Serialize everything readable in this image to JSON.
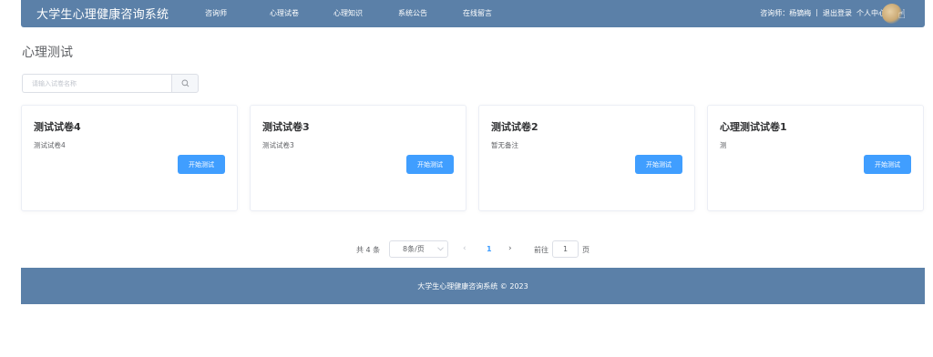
{
  "navbar": {
    "brand": "大学生心理健康咨询系统",
    "items": [
      "咨询师",
      "心理试卷",
      "心理知识",
      "系统公告",
      "在线留言"
    ],
    "user_label": "咨询师：杨镝梅",
    "separator": "|",
    "logout": "退出登录",
    "profile": "个人中心"
  },
  "page": {
    "title": "心理测试"
  },
  "search": {
    "placeholder": "请输入试卷名称"
  },
  "cards": [
    {
      "title": "测试试卷4",
      "note": "测试试卷4",
      "button": "开始测试"
    },
    {
      "title": "测试试卷3",
      "note": "测试试卷3",
      "button": "开始测试"
    },
    {
      "title": "测试试卷2",
      "note": "暂无备注",
      "button": "开始测试"
    },
    {
      "title": "心理测试试卷1",
      "note": "测",
      "button": "开始测试"
    }
  ],
  "pagination": {
    "total": "共 4 条",
    "page_size": "8条/页",
    "current_page": "1",
    "goto_label": "前往",
    "jump_value": "1",
    "page_unit": "页"
  },
  "footer": {
    "text": "大学生心理健康咨询系统 © 2023"
  },
  "colors": {
    "header_bg": "#5b80a8",
    "primary": "#409eff"
  }
}
